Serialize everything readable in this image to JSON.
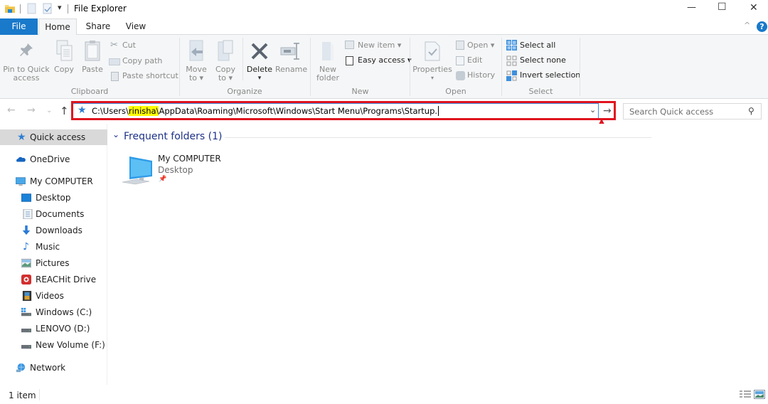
{
  "window": {
    "title": "File Explorer",
    "controls": {
      "minimize": "—",
      "maximize": "☐",
      "close": "✕"
    }
  },
  "ribbon_tabs": [
    {
      "label": "File"
    },
    {
      "label": "Home"
    },
    {
      "label": "Share"
    },
    {
      "label": "View"
    }
  ],
  "ribbon": {
    "clipboard": {
      "title": "Clipboard",
      "pin": "Pin to Quick\naccess",
      "pin_line1": "Pin to Quick",
      "pin_line2": "access",
      "copy": "Copy",
      "paste": "Paste",
      "cut": "Cut",
      "copy_path": "Copy path",
      "paste_shortcut": "Paste shortcut"
    },
    "organize": {
      "title": "Organize",
      "move_line1": "Move",
      "move_line2": "to ▾",
      "copy_line1": "Copy",
      "copy_line2": "to ▾",
      "delete": "Delete",
      "rename": "Rename"
    },
    "new": {
      "title": "New",
      "new_folder_line1": "New",
      "new_folder_line2": "folder",
      "new_item": "New item ▾",
      "easy_access": "Easy access ▾"
    },
    "open": {
      "title": "Open",
      "properties": "Properties",
      "open": "Open ▾",
      "edit": "Edit",
      "history": "History"
    },
    "select": {
      "title": "Select",
      "select_all": "Select all",
      "select_none": "Select none",
      "invert_selection": "Invert selection"
    }
  },
  "address_bar": {
    "path_prefix": "C:\\Users\\",
    "path_highlight": "rinisha\\",
    "path_suffix": "AppData\\Roaming\\Microsoft\\Windows\\Start Menu\\Programs\\Startup.",
    "go_arrow": "→"
  },
  "search": {
    "placeholder": "Search Quick access"
  },
  "sidebar": {
    "items": [
      {
        "label": "Quick access",
        "icon": "star-icon"
      },
      {
        "label": "OneDrive",
        "icon": "cloud-icon"
      },
      {
        "label": "My COMPUTER",
        "icon": "computer-icon"
      },
      {
        "label": "Desktop",
        "icon": "desktop-icon"
      },
      {
        "label": "Documents",
        "icon": "documents-icon"
      },
      {
        "label": "Downloads",
        "icon": "download-icon"
      },
      {
        "label": "Music",
        "icon": "music-icon"
      },
      {
        "label": "Pictures",
        "icon": "pictures-icon"
      },
      {
        "label": "REACHit Drive",
        "icon": "reachit-icon"
      },
      {
        "label": "Videos",
        "icon": "videos-icon"
      },
      {
        "label": "Windows (C:)",
        "icon": "drive-c-icon"
      },
      {
        "label": "LENOVO (D:)",
        "icon": "drive-icon"
      },
      {
        "label": "New Volume (F:)",
        "icon": "drive-icon"
      },
      {
        "label": "Network",
        "icon": "network-icon"
      }
    ]
  },
  "main": {
    "section_title": "Frequent folders (1)",
    "folders": [
      {
        "name": "My COMPUTER",
        "location": "Desktop",
        "pinned": true
      }
    ]
  },
  "status": {
    "item_count": "1 item"
  },
  "colors": {
    "accent": "#1979ca",
    "annotation_red": "#e0141e",
    "highlight": "#ffff00",
    "section_title": "#1e3287"
  }
}
